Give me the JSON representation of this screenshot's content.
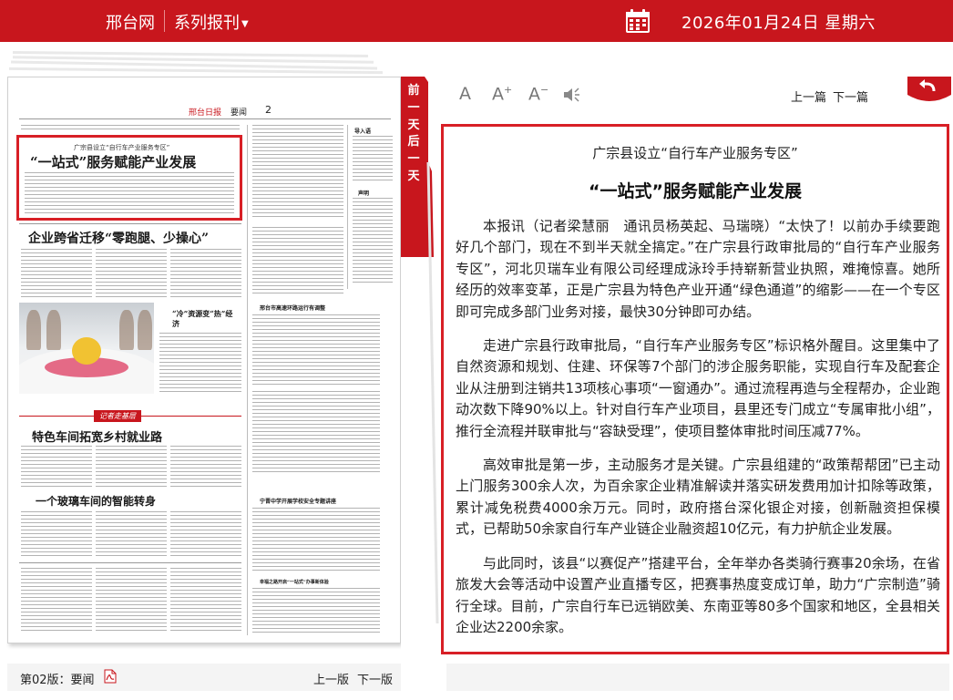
{
  "topbar": {
    "brand": "邢台网",
    "series": "系列报刊",
    "calendar_icon": "calendar-icon",
    "date": "2026年01月24日 星期六"
  },
  "newspaper": {
    "logo": "邢台日报",
    "section": "要闻",
    "page_number": "2",
    "highlight_sub": "广宗县设立“自行车产业服务专区”",
    "highlight_title": "“一站式”服务赋能产业发展",
    "headline_2": "企业跨省迁移“零跑腿、少操心”",
    "headline_3": "特色车间拓宽乡村就业路",
    "headline_4": "一个玻璃车间的智能转身",
    "column_label": "记者走基层",
    "side_title_1": "“冷”资源变“热”经济",
    "side_title_2": "邢台市高速环路运行有调整",
    "side_title_3": "宁晋中学开展学校安全专题讲座",
    "side_title_4": "幸福之路开启“一站式”办事新体验",
    "box_title": "导入语",
    "box_title_2": "声明"
  },
  "tabs": {
    "prev_day": "前一天",
    "next_day": "后一天"
  },
  "toolbar": {
    "font_default": "A",
    "font_increase": "A",
    "font_decrease": "A",
    "speaker_icon": "speaker-icon",
    "prev_article": "上一篇",
    "next_article": "下一篇",
    "back_icon": "back-arrow-icon"
  },
  "article": {
    "subtitle": "广宗县设立“自行车产业服务专区”",
    "title": "“一站式”服务赋能产业发展",
    "paragraphs": [
      "本报讯（记者梁慧丽　通讯员杨英起、马瑞晓）“太快了！以前办手续要跑好几个部门，现在不到半天就全搞定。”在广宗县行政审批局的“自行车产业服务专区”，河北贝瑞车业有限公司经理成泳玲手持崭新营业执照，难掩惊喜。她所经历的效率变革，正是广宗县为特色产业开通“绿色通道”的缩影——在一个专区即可完成多部门业务对接，最快30分钟即可办结。",
      "走进广宗县行政审批局，“自行车产业服务专区”标识格外醒目。这里集中了自然资源和规划、住建、环保等7个部门的涉企服务职能，实现自行车及配套企业从注册到注销共13项核心事项“一窗通办”。通过流程再造与全程帮办，企业跑动次数下降90%以上。针对自行车产业项目，县里还专门成立“专属审批小组”，推行全流程并联审批与“容缺受理”，使项目整体审批时间压减77%。",
      "高效审批是第一步，主动服务才是关键。广宗县组建的“政策帮帮团”已主动上门服务300余人次，为百余家企业精准解读并落实研发费用加计扣除等政策，累计减免税费4000余万元。同时，政府搭台深化银企对接，创新融资担保模式，已帮助50余家自行车产业链企业融资超10亿元，有力护航企业发展。",
      "与此同时，该县“以赛促产”搭建平台，全年举办各类骑行赛事20余场，在省旅发大会等活动中设置产业直播专区，把赛事热度变成订单，助力“广宗制造”骑行全球。目前，广宗自行车已远销欧美、东南亚等80多个国家和地区，全县相关企业达2200余家。"
    ]
  },
  "footer": {
    "edition": "第02版：要闻",
    "pdf_icon": "pdf-icon",
    "prev_edition": "上一版",
    "next_edition": "下一版"
  }
}
